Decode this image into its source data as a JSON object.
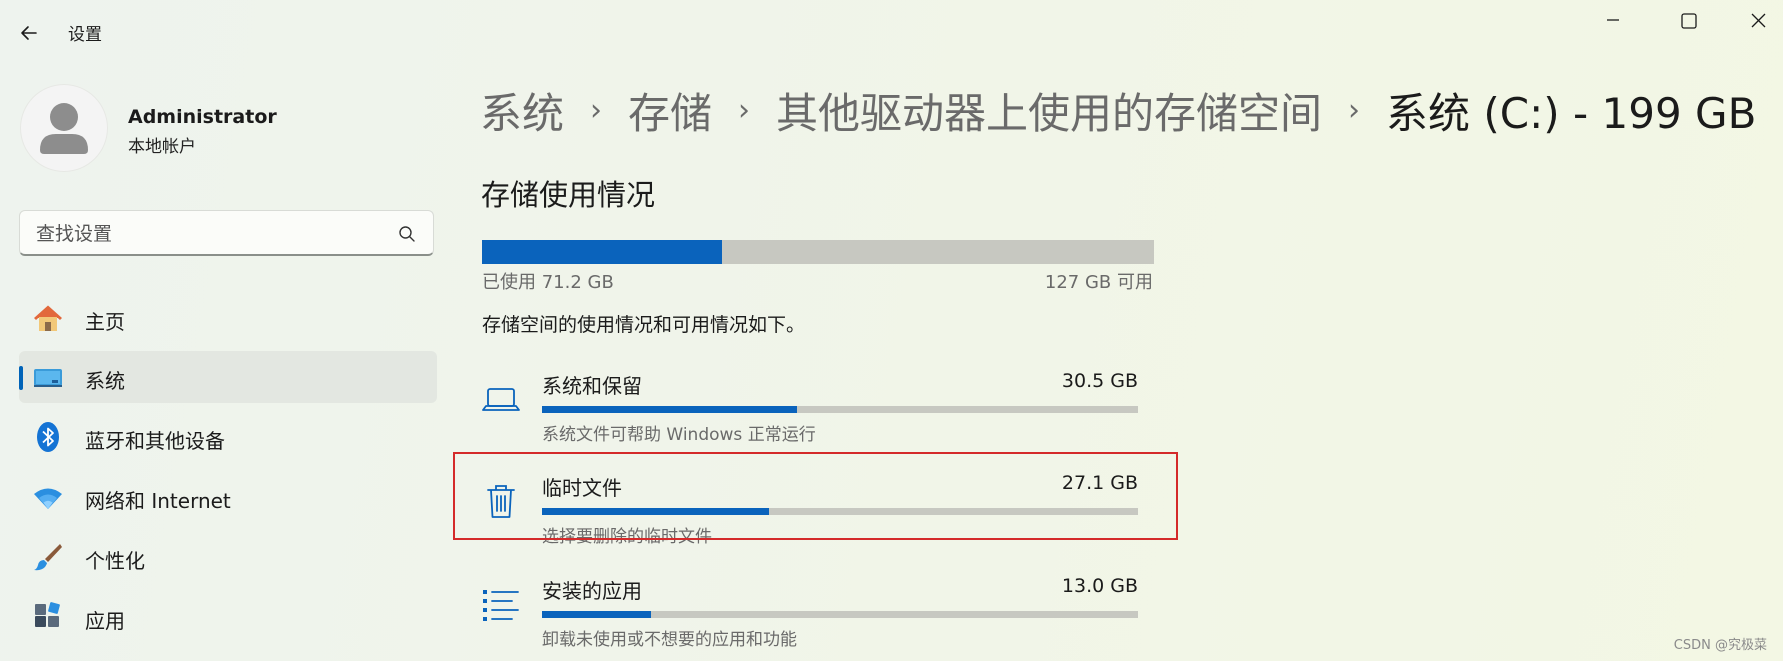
{
  "window": {
    "app_title": "设置"
  },
  "user": {
    "name": "Administrator",
    "account_type": "本地帐户"
  },
  "search": {
    "placeholder": "查找设置"
  },
  "sidebar": {
    "items": [
      {
        "label": "主页",
        "icon": "home-icon"
      },
      {
        "label": "系统",
        "icon": "system-monitor-icon",
        "active": true
      },
      {
        "label": "蓝牙和其他设备",
        "icon": "bluetooth-icon"
      },
      {
        "label": "网络和 Internet",
        "icon": "wifi-icon"
      },
      {
        "label": "个性化",
        "icon": "paintbrush-icon"
      },
      {
        "label": "应用",
        "icon": "apps-icon"
      }
    ]
  },
  "breadcrumb": [
    "系统",
    "存储",
    "其他驱动器上使用的存储空间",
    "系统 (C:) - 199 GB"
  ],
  "main": {
    "section_title": "存储使用情况",
    "used_label": "已使用 71.2 GB",
    "free_label": "127 GB 可用",
    "used_fraction": 0.357,
    "description": "存储空间的使用情况和可用情况如下。",
    "categories": [
      {
        "name": "系统和保留",
        "size": "30.5 GB",
        "subtitle": "系统文件可帮助 Windows 正常运行",
        "fraction": 0.428,
        "icon": "laptop-icon"
      },
      {
        "name": "临时文件",
        "size": "27.1 GB",
        "subtitle": "选择要删除的临时文件",
        "fraction": 0.381,
        "icon": "trash-icon"
      },
      {
        "name": "安装的应用",
        "size": "13.0 GB",
        "subtitle": "卸载未使用或不想要的应用和功能",
        "fraction": 0.183,
        "icon": "list-icon"
      }
    ]
  },
  "colors": {
    "accent": "#0a63bc",
    "highlight_box": "#d42a2a"
  },
  "watermark": "CSDN @究极菜"
}
